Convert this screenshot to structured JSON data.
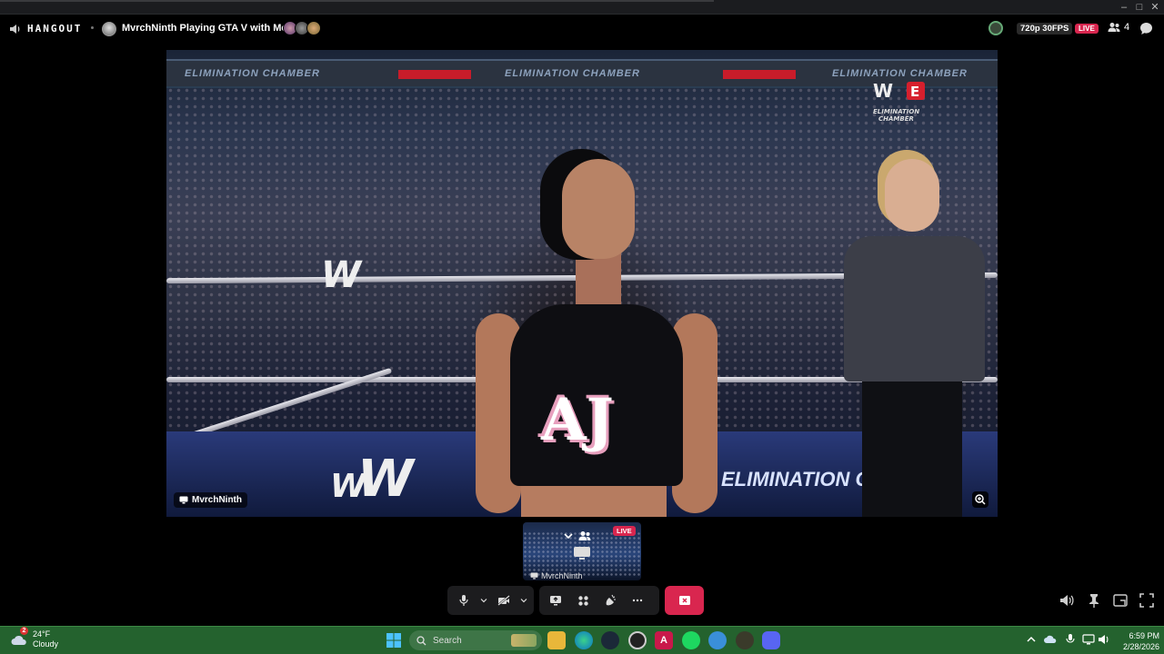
{
  "window": {
    "minimize": "–",
    "maximize": "□",
    "close": "✕"
  },
  "header": {
    "brand": "HANGOUT",
    "room_title": "MvrchNinth Playing GTA V with Medal",
    "quality": "720p 30FPS",
    "live": "LIVE",
    "viewer_count": "4"
  },
  "stream": {
    "banner_text": "ELIMINATION CHAMBER",
    "scorebug_text": "ELIMINATION CHAMBER",
    "shirt_text": "AJ",
    "wwe": "W",
    "apron_text": "ELIMINATION CHAMBER",
    "presenter_name": "MvrchNinth"
  },
  "preview_tile": {
    "live": "LIVE",
    "name": "MvrchNinth"
  },
  "colors": {
    "accent_live": "#d9264f",
    "taskbar": "#24622e"
  },
  "taskbar": {
    "weather_temp": "24°F",
    "weather_desc": "Cloudy",
    "weather_badge": "2",
    "search_placeholder": "Search",
    "time": "6:59 PM",
    "date": "2/28/2026"
  }
}
